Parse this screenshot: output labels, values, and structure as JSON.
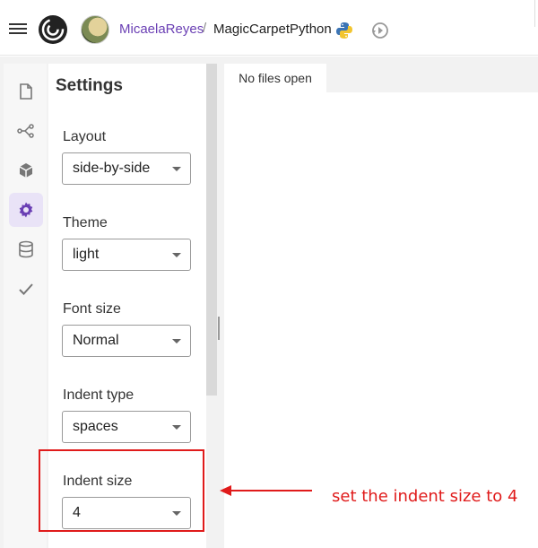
{
  "header": {
    "user": "MicaelaReyes",
    "separator": "/",
    "repo": "MagicCarpetPython"
  },
  "rail": {
    "items": [
      {
        "icon": "file-icon",
        "active": false
      },
      {
        "icon": "share-nodes-icon",
        "active": false
      },
      {
        "icon": "cube-icon",
        "active": false
      },
      {
        "icon": "gear-icon",
        "active": true
      },
      {
        "icon": "database-icon",
        "active": false
      },
      {
        "icon": "check-icon",
        "active": false
      }
    ]
  },
  "settings": {
    "title": "Settings",
    "layout": {
      "label": "Layout",
      "value": "side-by-side"
    },
    "theme": {
      "label": "Theme",
      "value": "light"
    },
    "font_size": {
      "label": "Font size",
      "value": "Normal"
    },
    "indent_type": {
      "label": "Indent type",
      "value": "spaces"
    },
    "indent_size": {
      "label": "Indent size",
      "value": "4"
    }
  },
  "editor": {
    "tab_label": "No files open"
  },
  "annotation": {
    "text": "set the indent size to 4",
    "color": "#e01b1b"
  },
  "colors": {
    "accent": "#6a3fb4",
    "active_rail_bg": "#e9e3f7"
  }
}
